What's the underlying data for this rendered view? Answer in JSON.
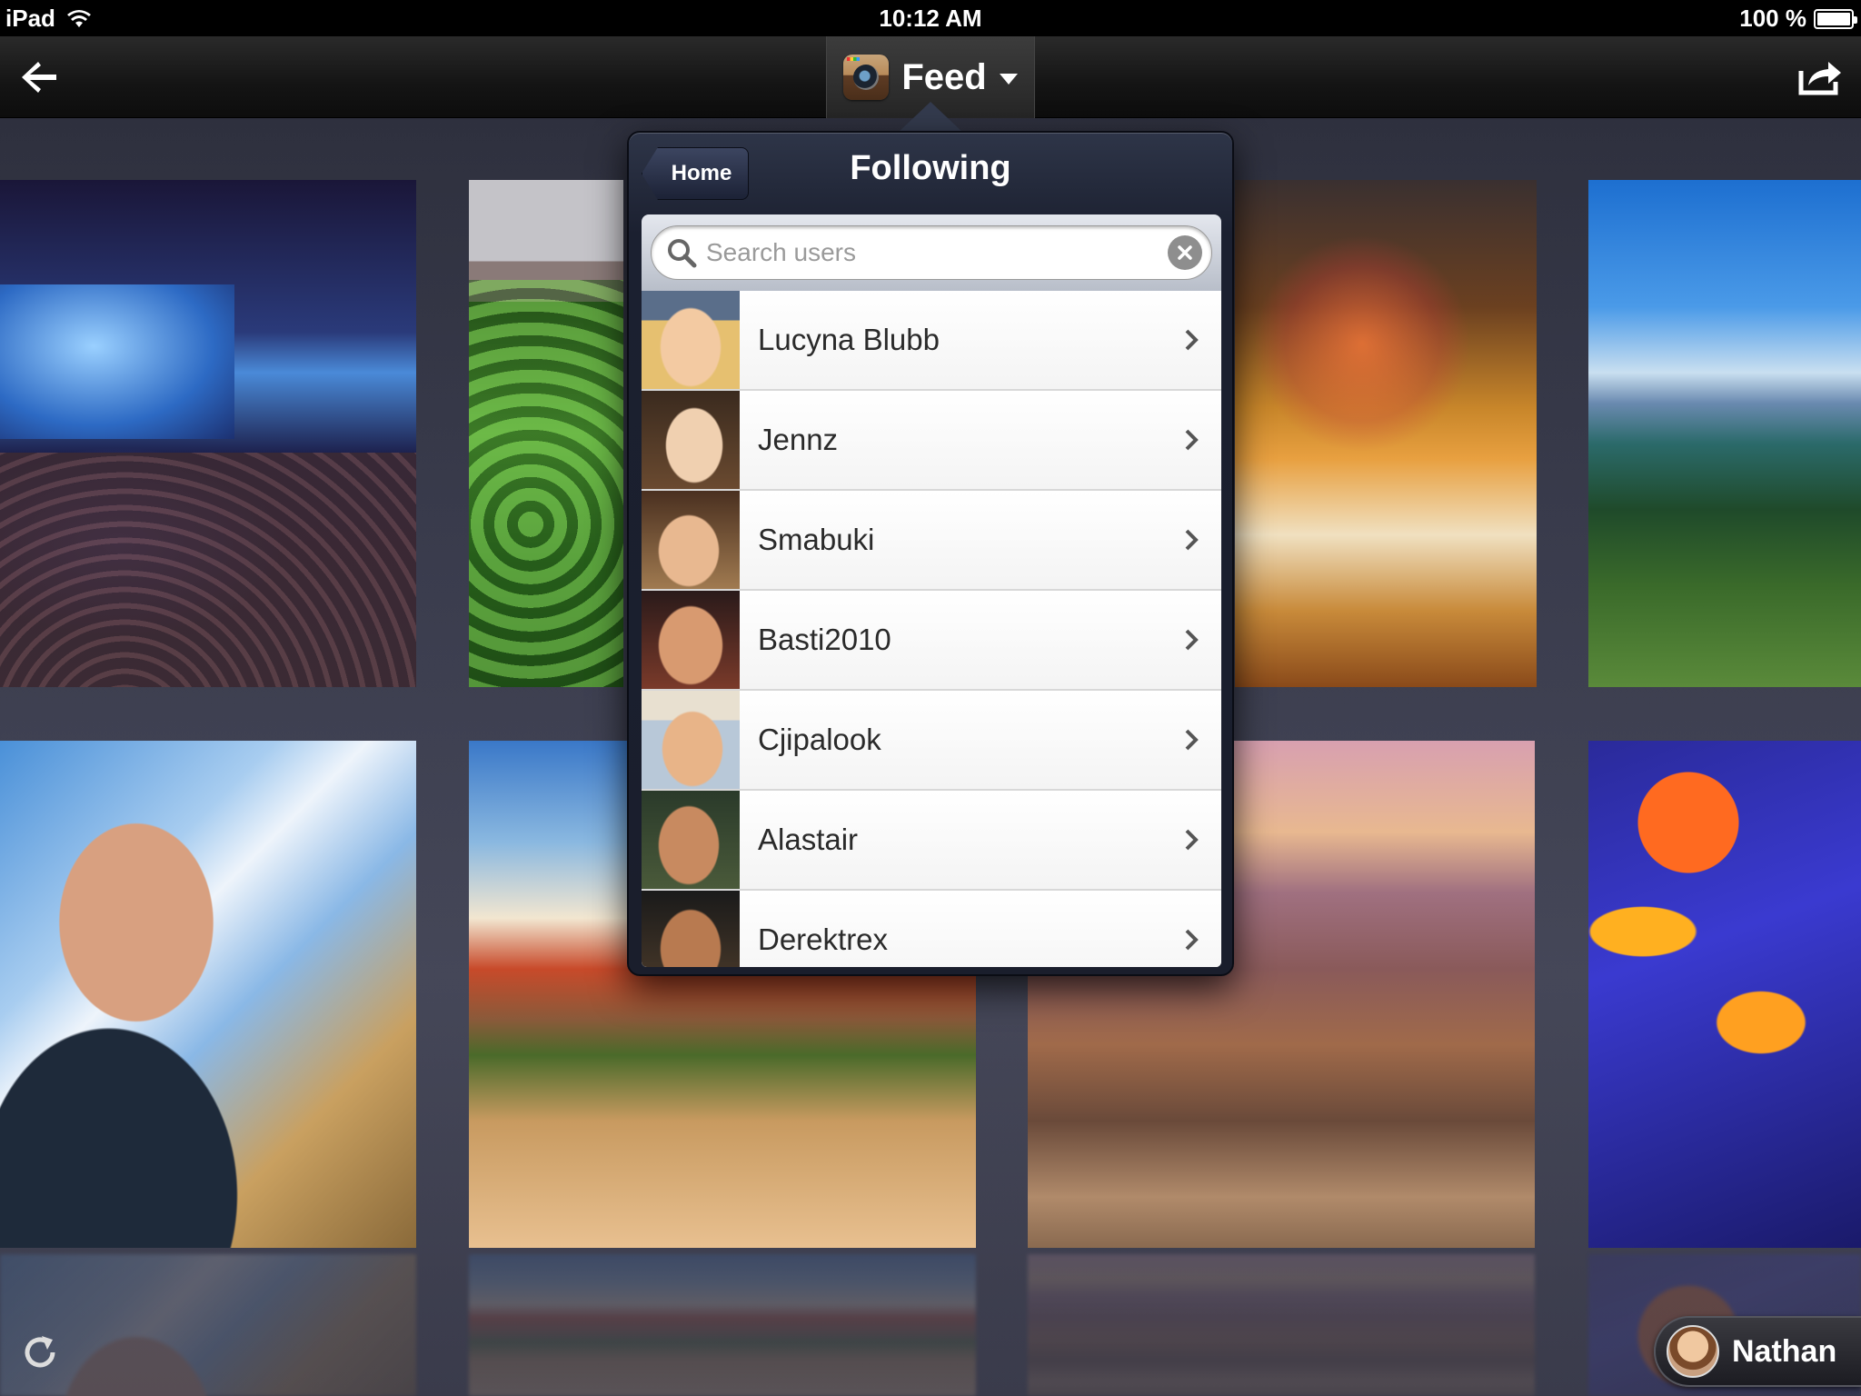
{
  "status_bar": {
    "device": "iPad",
    "time": "10:12 AM",
    "battery": "100 %",
    "battery_level": 1.0
  },
  "nav": {
    "title": "Feed",
    "back_icon": "back-arrow-icon",
    "share_icon": "share-icon",
    "app_icon": "instagram-camera-icon"
  },
  "popover": {
    "title": "Following",
    "back_button": "Home",
    "search": {
      "placeholder": "Search users",
      "value": ""
    },
    "users": [
      {
        "name": "Lucyna Blubb"
      },
      {
        "name": "Jennz"
      },
      {
        "name": "Smabuki"
      },
      {
        "name": "Basti2010"
      },
      {
        "name": "Cjipalook"
      },
      {
        "name": "Alastair"
      },
      {
        "name": "Derektrex"
      }
    ]
  },
  "current_user": {
    "name": "Nathan"
  },
  "colors": {
    "background": "#3a3c4d",
    "navbar": "#141414",
    "popover": "#1b2030",
    "list_background": "#ffffff"
  }
}
